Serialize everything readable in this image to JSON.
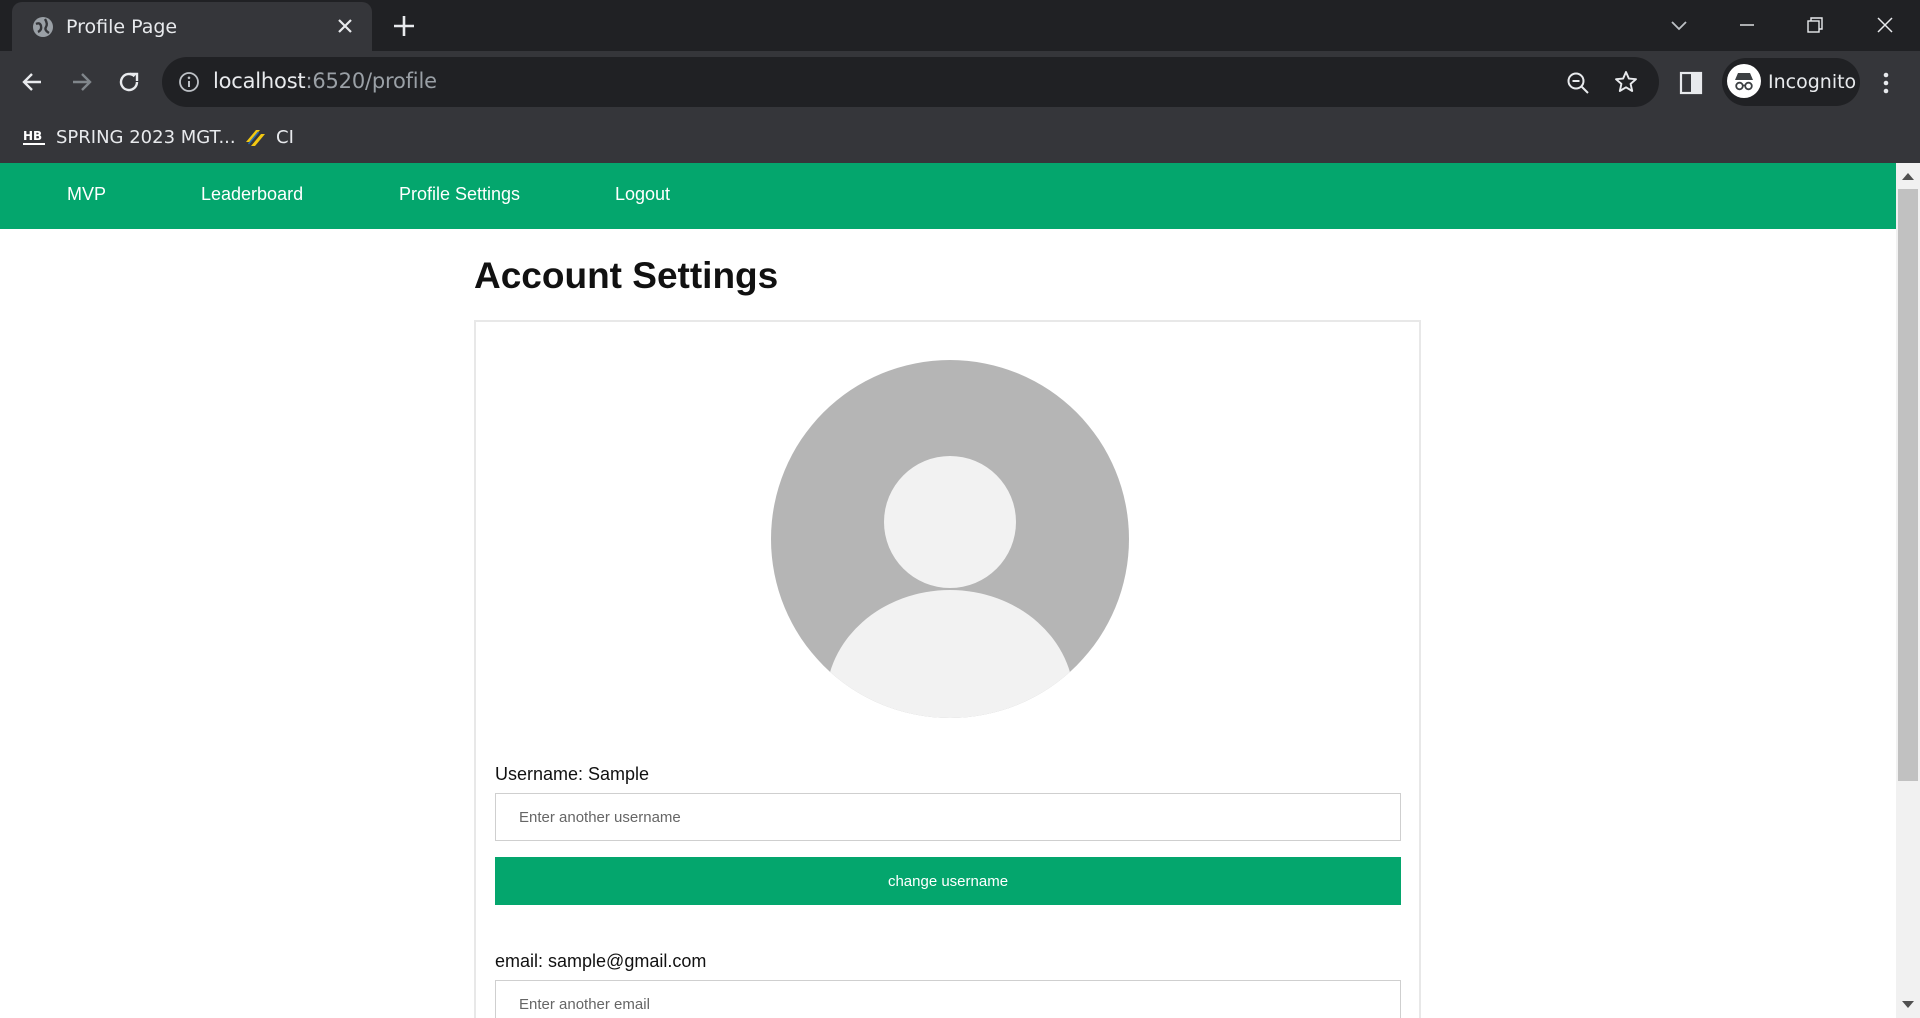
{
  "browser": {
    "tab": {
      "title": "Profile Page"
    },
    "url": {
      "host": "localhost",
      "rest": ":6520/profile"
    },
    "profile_label": "Incognito",
    "bookmarks": [
      {
        "label": "SPRING 2023 MGT...",
        "icon": "hb-icon"
      },
      {
        "label": "CI",
        "icon": "ci-icon"
      }
    ]
  },
  "navbar": {
    "links": [
      {
        "label": "MVP"
      },
      {
        "label": "Leaderboard"
      },
      {
        "label": "Profile Settings"
      },
      {
        "label": "Logout"
      }
    ],
    "color": "#04a66d"
  },
  "page": {
    "title": "Account Settings",
    "username": {
      "label": "Username: Sample",
      "placeholder": "Enter another username",
      "button": "change username"
    },
    "email": {
      "label": "email: sample@gmail.com",
      "placeholder": "Enter another email"
    }
  }
}
